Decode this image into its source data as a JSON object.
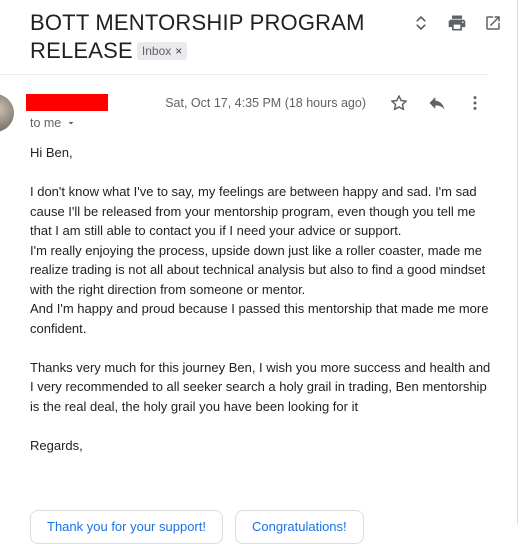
{
  "email": {
    "subject": "BOTT MENTORSHIP PROGRAM RELEASE",
    "label_badge": "Inbox",
    "badge_close": "×",
    "date": "Sat, Oct 17, 4:35 PM (18 hours ago)",
    "recipient": "to me",
    "body": {
      "greeting": "Hi Ben,",
      "paragraph_1": "I don't know what I've to say, my feelings are between happy and sad. I'm sad cause I'll be released from your mentorship program, even though you tell me that I am still able to contact you if I need your advice or support.",
      "paragraph_2": "I'm really enjoying the process, upside down just like a roller coaster, made me realize trading is not all about technical analysis but also to find a good mindset with the right direction from someone or mentor.",
      "paragraph_3": "And I'm happy and proud because I passed this mentorship that made me more confident.",
      "paragraph_4": "Thanks very much for this journey Ben, I wish you more success and health and I very recommended to all seeker search a holy grail in trading, Ben mentorship is the real deal, the holy grail you have been looking for it",
      "signoff": "Regards,"
    }
  },
  "smart_replies": [
    "Thank you for your support!",
    "Congratulations!"
  ],
  "icons": {
    "top": [
      "expand-collapse-icon",
      "print-icon",
      "open-in-new-window-icon"
    ],
    "message": [
      "star-icon",
      "reply-icon",
      "more-vert-icon"
    ]
  }
}
